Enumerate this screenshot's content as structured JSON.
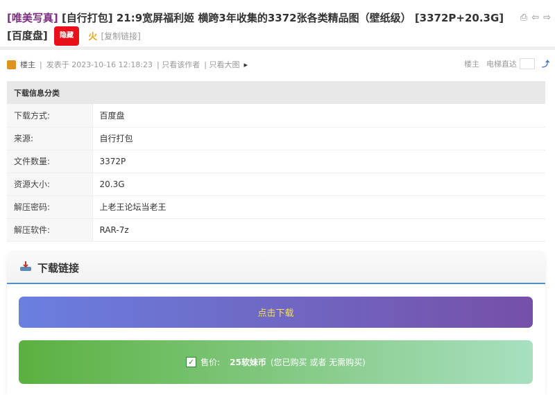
{
  "thread": {
    "category": "[唯美写真]",
    "title": " [自行打包] 21:9宽屏福利姬 横跨3年收集的3372张各类精品图（壁纸级） [3372P+20.3G] [百度盘]",
    "badge": "隐藏",
    "fire": "火",
    "copy_link": "[复制链接]"
  },
  "tools": {
    "print": "⎙",
    "prev": "⇦",
    "next": "⇨"
  },
  "meta": {
    "author": "楼主",
    "sep": "|",
    "posted": "发表于 2023-10-16 12:18:23",
    "only_author": "| 只看该作者",
    "only_images": "| 只看大图",
    "arrow": "▸",
    "floor": "楼主",
    "elevator": "电梯直达",
    "go": "⤴"
  },
  "info": {
    "header": "下载信息分类",
    "rows": [
      {
        "k": "下载方式:",
        "v": "百度盘"
      },
      {
        "k": "来源:",
        "v": "自行打包"
      },
      {
        "k": "文件数量:",
        "v": "3372P"
      },
      {
        "k": "资源大小:",
        "v": "20.3G"
      },
      {
        "k": "解压密码:",
        "v": "上老王论坛当老王"
      },
      {
        "k": "解压软件:",
        "v": "RAR-7z"
      }
    ]
  },
  "download": {
    "title": "下载链接",
    "button": "点击下载",
    "check": "✓",
    "price_label": "售价:",
    "price_value": "25软妹币",
    "price_note": "(您已购买 或者 无需购买)"
  }
}
